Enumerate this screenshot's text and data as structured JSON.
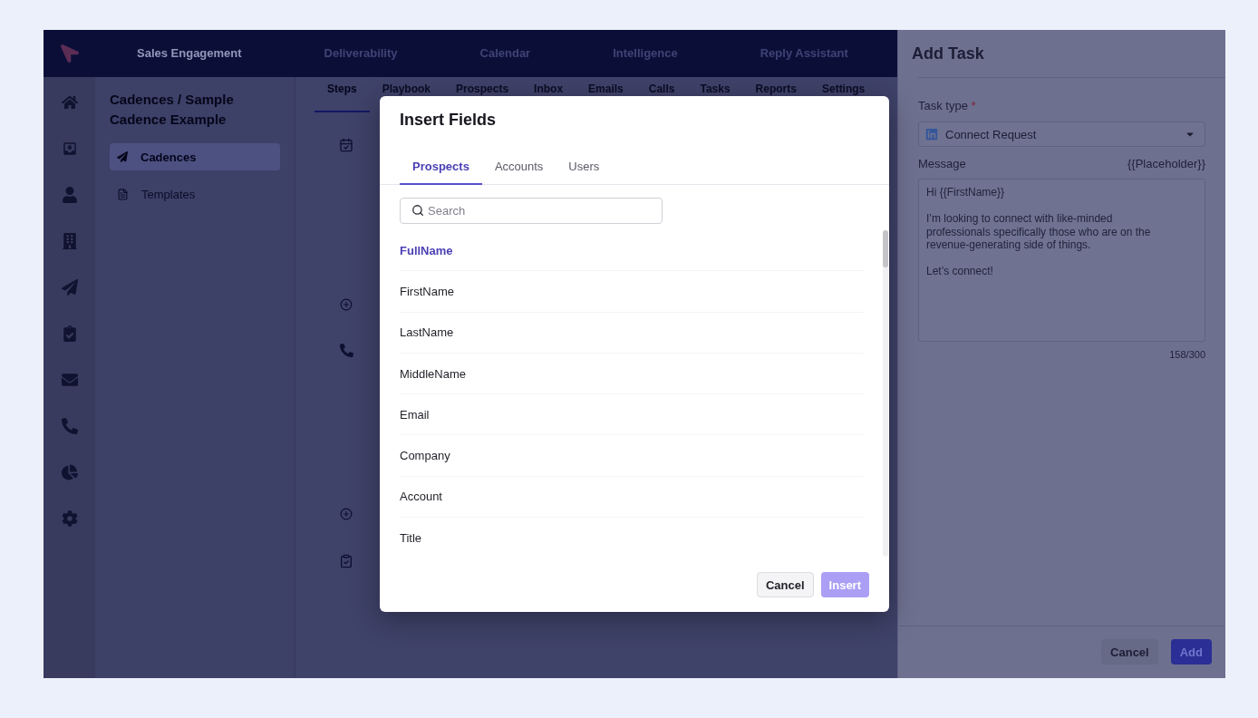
{
  "top_nav": {
    "items": [
      {
        "label": "Sales Engagement",
        "selected": true
      },
      {
        "label": "Deliverability",
        "selected": false
      },
      {
        "label": "Calendar",
        "selected": false
      },
      {
        "label": "Intelligence",
        "selected": false
      },
      {
        "label": "Reply Assistant",
        "selected": false
      }
    ]
  },
  "sidebar": {
    "breadcrumb": "Cadences / Sample Cadence Example",
    "items": [
      {
        "label": "Cadences",
        "kind": "cadences",
        "selected": true
      },
      {
        "label": "Templates",
        "kind": "templates",
        "selected": false
      }
    ]
  },
  "cadence_tabs": [
    {
      "label": "Steps",
      "selected": true
    },
    {
      "label": "Playbook",
      "selected": false
    },
    {
      "label": "Prospects",
      "selected": false
    },
    {
      "label": "Inbox",
      "selected": false
    },
    {
      "label": "Emails",
      "selected": false
    },
    {
      "label": "Calls",
      "selected": false
    },
    {
      "label": "Tasks",
      "selected": false
    },
    {
      "label": "Reports",
      "selected": false
    },
    {
      "label": "Settings",
      "selected": false
    }
  ],
  "insert_fields_dialog": {
    "title": "Insert Fields",
    "tabs": [
      {
        "label": "Prospects",
        "selected": true
      },
      {
        "label": "Accounts",
        "selected": false
      },
      {
        "label": "Users",
        "selected": false
      }
    ],
    "search": {
      "placeholder": "Search"
    },
    "fields": [
      {
        "label": "FullName",
        "selected": true
      },
      {
        "label": "FirstName",
        "selected": false
      },
      {
        "label": "LastName",
        "selected": false
      },
      {
        "label": "MiddleName",
        "selected": false
      },
      {
        "label": "Email",
        "selected": false
      },
      {
        "label": "Company",
        "selected": false
      },
      {
        "label": "Account",
        "selected": false
      },
      {
        "label": "Title",
        "selected": false
      }
    ],
    "buttons": [
      {
        "label": "Cancel",
        "kind": "secondary",
        "disabled": false
      },
      {
        "label": "Insert",
        "kind": "primary",
        "disabled": true
      }
    ]
  },
  "add_task_panel": {
    "title": "Add Task",
    "task_type": {
      "label": "Task type",
      "required_mark": "*",
      "value": "Connect Request"
    },
    "message": {
      "label": "Message",
      "insert_link": "{{Placeholder}}",
      "value": "Hi {{FirstName}}\n\nI’m looking to connect with like-minded professionals specifically those who are on the revenue-generating side of things.\n\nLet’s connect!",
      "counter": "158/300"
    },
    "buttons": [
      {
        "label": "Cancel",
        "kind": "secondary"
      },
      {
        "label": "Add",
        "kind": "primary"
      }
    ]
  }
}
